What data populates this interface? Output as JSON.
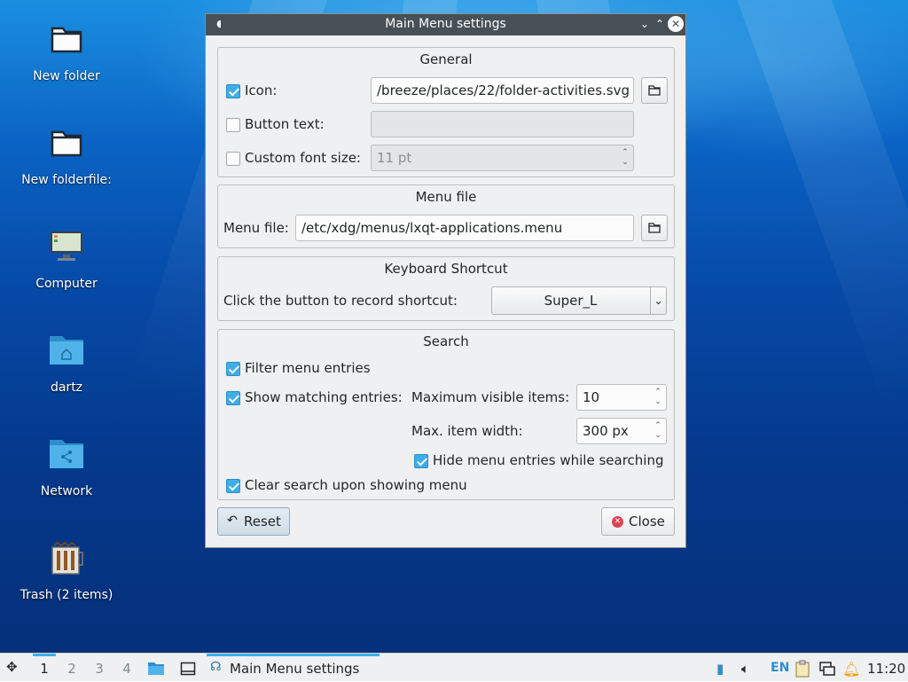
{
  "desktop": {
    "icons": [
      {
        "label": "New folder",
        "icon": "folder-icon"
      },
      {
        "label": "New folderfile:",
        "icon": "folder-icon"
      },
      {
        "label": "Computer",
        "icon": "computer-icon"
      },
      {
        "label": "dartz",
        "icon": "home-folder-icon"
      },
      {
        "label": "Network",
        "icon": "network-folder-icon"
      },
      {
        "label": "Trash (2 items)",
        "icon": "trash-icon"
      }
    ]
  },
  "dialog": {
    "title": "Main Menu settings",
    "general": {
      "title": "General",
      "icon_label": "Icon:",
      "icon_checked": true,
      "icon_value": "/breeze/places/22/folder-activities.svg",
      "button_text_label": "Button text:",
      "button_text_checked": false,
      "button_text_value": "",
      "font_size_label": "Custom font size:",
      "font_size_checked": false,
      "font_size_value": "11 pt"
    },
    "menu_file": {
      "title": "Menu file",
      "label": "Menu file:",
      "value": "/etc/xdg/menus/lxqt-applications.menu"
    },
    "shortcut": {
      "title": "Keyboard Shortcut",
      "label": "Click the button to record shortcut:",
      "value": "Super_L"
    },
    "search": {
      "title": "Search",
      "filter_label": "Filter menu entries",
      "filter_checked": true,
      "show_matching_label": "Show matching entries:",
      "show_matching_checked": true,
      "max_visible_label": "Maximum visible items:",
      "max_visible_value": "10",
      "max_width_label": "Max. item width:",
      "max_width_value": "300 px",
      "hide_entries_label": "Hide menu entries while searching",
      "hide_entries_checked": true,
      "clear_search_label": "Clear search upon showing menu",
      "clear_search_checked": true
    },
    "reset_label": "Reset",
    "close_label": "Close"
  },
  "taskbar": {
    "workspaces": [
      "1",
      "2",
      "3",
      "4"
    ],
    "active_workspace": "1",
    "task_label": "Main Menu settings",
    "keyboard_layout": "EN",
    "clock": "11:20"
  },
  "colors": {
    "accent": "#3daee9",
    "titlebar": "#475057",
    "close_red": "#da4453"
  }
}
